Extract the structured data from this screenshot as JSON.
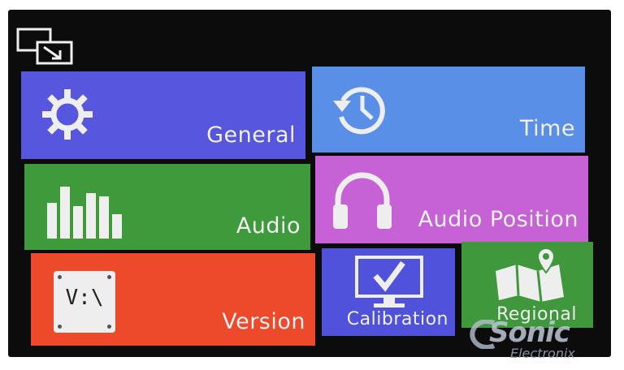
{
  "colors": {
    "general": "#5656de",
    "time": "#5a8fe8",
    "audio": "#3f9a3c",
    "audio_position": "#c762d6",
    "version": "#ec4a2b",
    "calibration": "#5152dc",
    "regional": "#3f983b"
  },
  "icons": {
    "back": "window-switch-icon",
    "general": "gear-icon",
    "time": "clock-history-icon",
    "audio": "equalizer-bars-icon",
    "audio_position": "headphones-icon",
    "version": "version-badge-icon",
    "calibration": "monitor-check-icon",
    "regional": "map-pin-icon"
  },
  "tiles": {
    "general": {
      "label": "General"
    },
    "time": {
      "label": "Time"
    },
    "audio": {
      "label": "Audio"
    },
    "audio_position": {
      "label": "Audio Position"
    },
    "version": {
      "label": "Version",
      "badge": "V:\\"
    },
    "calibration": {
      "label": "Calibration"
    },
    "regional": {
      "label": "Regional"
    }
  },
  "watermark": {
    "brand": "Sonic",
    "sub": "Electronix"
  }
}
